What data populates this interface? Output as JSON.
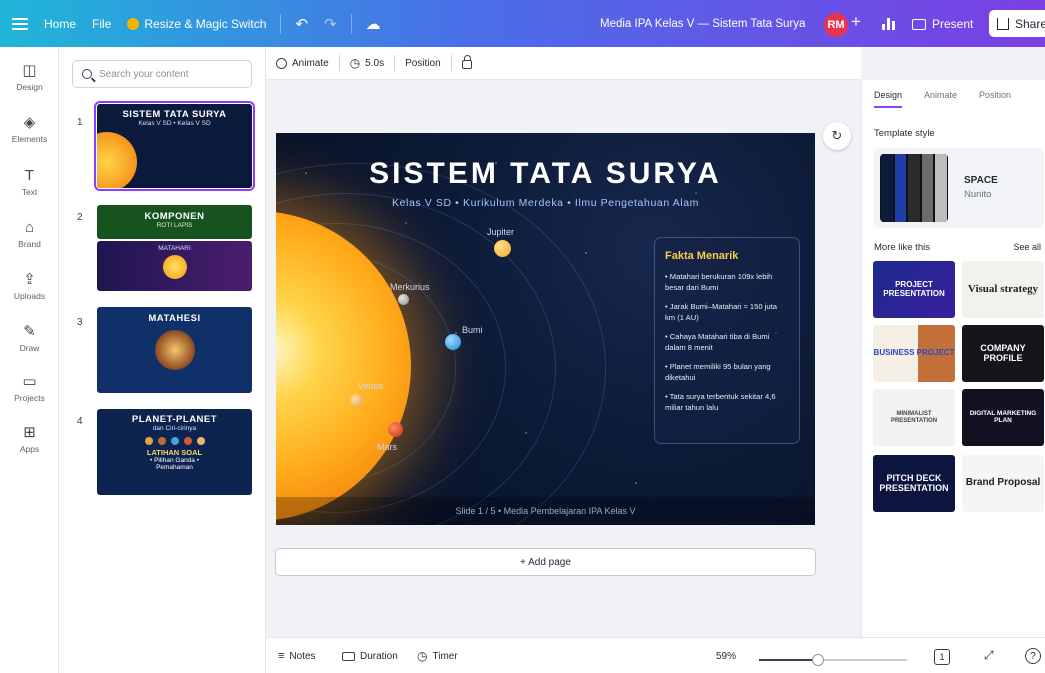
{
  "topbar": {
    "home": "Home",
    "file": "File",
    "resize": "Resize & Magic Switch",
    "doc_title": "Media IPA Kelas V — Sistem Tata Surya",
    "avatar": "RM",
    "present": "Present",
    "share": "Share"
  },
  "rail": {
    "items": [
      "Design",
      "Elements",
      "Text",
      "Brand",
      "Uploads",
      "Draw",
      "Projects",
      "Apps"
    ]
  },
  "panel": {
    "search_placeholder": "Search your content",
    "slides": [
      {
        "num": "1",
        "title": "SISTEM TATA SURYA",
        "sub": "Kelas V SD  •  Kelas V SD"
      },
      {
        "num": "2",
        "title": "KOMPONEN",
        "sub": "ROTI LAPIS",
        "sub2": "MATAHARI"
      },
      {
        "num": "3",
        "title": "MATAHESI"
      },
      {
        "num": "4",
        "title": "PLANET-PLANET",
        "sub": "dan Ciri-cirinya",
        "sub2": "LATIHAN SOAL",
        "sub3": "• Pilihan Ganda •",
        "sub4": "Pemahaman"
      }
    ]
  },
  "canvas_toolbar": {
    "animate": "Animate",
    "duration": "5.0s",
    "position": "Position"
  },
  "slide": {
    "title": "SISTEM TATA SURYA",
    "subtitle": "Kelas V SD  •  Kurikulum Merdeka  •  Ilmu Pengetahuan Alam",
    "planets": {
      "jupiter": "Jupiter",
      "merkurius": "Merkurius",
      "bumi": "Bumi",
      "venus": "Venus",
      "mars": "Mars"
    },
    "fact_title": "Fakta Menarik",
    "facts": [
      "• Matahari berukuran 109x lebih besar dari Bumi",
      "• Jarak Bumi–Matahari ≈ 150 juta km (1 AU)",
      "• Cahaya Matahari tiba di Bumi dalam 8 menit",
      "• Planet memiliki 95 bulan yang diketahui",
      "• Tata surya terbentuk sekitar 4,6 miliar tahun lalu"
    ],
    "footer": "Slide 1 / 5  •  Media Pembelajaran IPA Kelas V",
    "colors": {
      "title": "#ffffff",
      "accent": "#ffc94a",
      "subtitle": "#9fc6ff"
    }
  },
  "add_page": "+ Add page",
  "bottombar": {
    "notes": "Notes",
    "duration": "Duration",
    "timer": "Timer",
    "zoom": "59%",
    "zoom_value": 0.4,
    "page": "1"
  },
  "right_panel": {
    "tabs": [
      "Design",
      "Animate",
      "Position"
    ],
    "template_style": "Template style",
    "style_name": "SPACE",
    "style_font": "Nunito",
    "swatch_colors": [
      "#0d1b3d",
      "#1f3fa8",
      "#2b2b2b",
      "#6b6b6b",
      "#bdbdbd"
    ],
    "more_like_this": "More like this",
    "see_all": "See all",
    "templates": [
      {
        "label": "PROJECT PRESENTATION"
      },
      {
        "label": "Visual strategy"
      },
      {
        "label": "BUSINESS PROJECT"
      },
      {
        "label": "COMPANY PROFILE"
      },
      {
        "label": "MINIMALIST PRESENTATION"
      },
      {
        "label": "DIGITAL MARKETING PLAN"
      },
      {
        "label": "PITCH DECK PRESENTATION"
      },
      {
        "label": "Brand Proposal"
      }
    ]
  }
}
